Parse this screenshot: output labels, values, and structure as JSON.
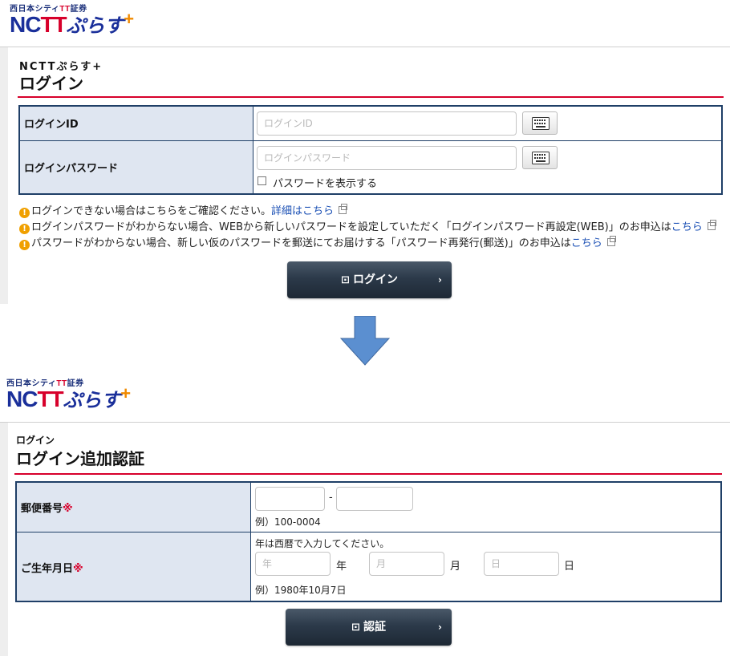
{
  "logo": {
    "subtitle_prefix": "西日本シティ",
    "subtitle_tt": "TT",
    "subtitle_suffix": "証券",
    "main_nc": "NC",
    "main_tt": "TT",
    "main_plus_text": "ぷらす",
    "main_plus_sign": "+"
  },
  "login": {
    "breadcrumb": "NCTTぷらす+",
    "title": "ログイン",
    "id_label": "ログインID",
    "id_placeholder": "ログインID",
    "password_label": "ログインパスワード",
    "password_placeholder": "ログインパスワード",
    "show_password_label": "パスワードを表示する",
    "notes": [
      {
        "text": "ログインできない場合はこちらをご確認ください。",
        "link": "詳細はこちら"
      },
      {
        "text": "ログインパスワードがわからない場合、WEBから新しいパスワードを設定していただく「ログインパスワード再設定(WEB)」のお申込は",
        "link": "こちら"
      },
      {
        "text": "パスワードがわからない場合、新しい仮のパスワードを郵送にてお届けする「パスワード再発行(郵送)」のお申込は",
        "link": "こちら"
      }
    ],
    "button_label": "ログイン"
  },
  "auth": {
    "breadcrumb": "ログイン",
    "title": "ログイン追加認証",
    "postal_label": "郵便番号",
    "required_mark": "※",
    "postal_separator": "-",
    "postal_example": "例）100-0004",
    "birth_label": "ご生年月日",
    "birth_instruction": "年は西暦で入力してください。",
    "year_placeholder": "年",
    "year_unit": "年",
    "month_placeholder": "月",
    "month_unit": "月",
    "day_placeholder": "日",
    "day_unit": "日",
    "birth_example": "例）1980年10月7日",
    "button_label": "認証"
  },
  "colors": {
    "arrow": "#5b8fd0",
    "table_border": "#1f3f67",
    "label_bg": "#dfe6f1",
    "accent_red": "#d7002b",
    "link": "#1a4fb4"
  },
  "icons": [
    "keyboard-icon",
    "login-icon",
    "chevron-right-icon",
    "external-link-icon",
    "alert-icon",
    "down-arrow-icon"
  ]
}
